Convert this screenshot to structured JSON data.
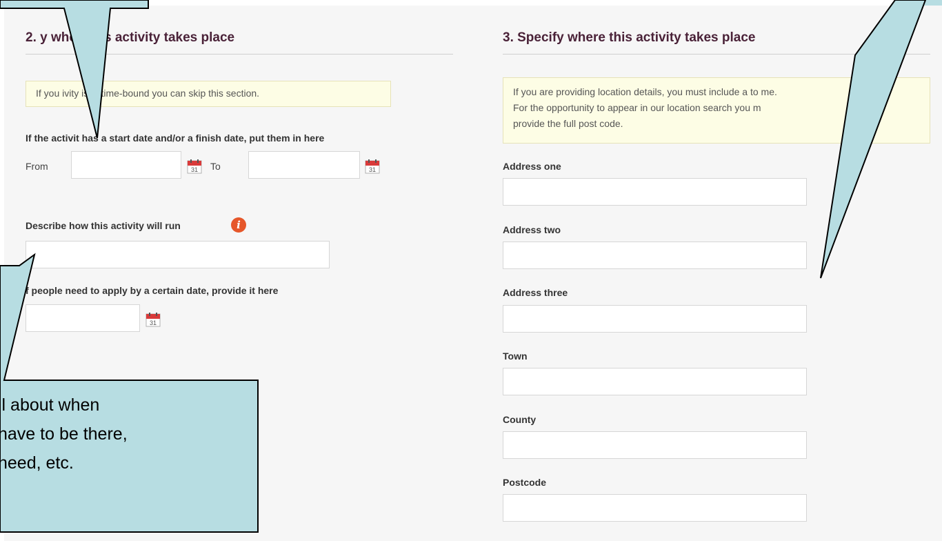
{
  "left_section": {
    "title": "2.    y when this activity takes place",
    "note": "If you    ivity isn't time-bound you can skip this section.",
    "dates_label": "If the activit  has a start date and/or a finish date, put them in here",
    "from_label": "From",
    "to_label": "To",
    "from_value": "",
    "to_value": "",
    "describe_label": "Describe how this activity will run",
    "describe_value": "",
    "apply_label": "f people need to apply by a certain date, provide it here",
    "apply_value": ""
  },
  "right_section": {
    "title": "3. Specify where this activity takes place",
    "note_line1": "If you are providing location details, you must include a to        me.",
    "note_line2": "For the opportunity to appear in our location search you m",
    "note_line3": "provide the full post code.",
    "fields": [
      {
        "label": "Address one",
        "value": ""
      },
      {
        "label": "Address two",
        "value": ""
      },
      {
        "label": "Address three",
        "value": ""
      },
      {
        "label": "Town",
        "value": ""
      },
      {
        "label": "County",
        "value": ""
      },
      {
        "label": "Postcode",
        "value": ""
      }
    ]
  },
  "calendar_icon_day": "31",
  "callout": {
    "line1": "il about when",
    "line2": "have to be there,",
    "line3": "need, etc."
  },
  "colors": {
    "heading": "#4a2238",
    "note_bg": "#fdfde5",
    "callout_fill": "#b7dde2",
    "info_icon": "#e6572a",
    "calendar_red": "#d93a3a"
  }
}
